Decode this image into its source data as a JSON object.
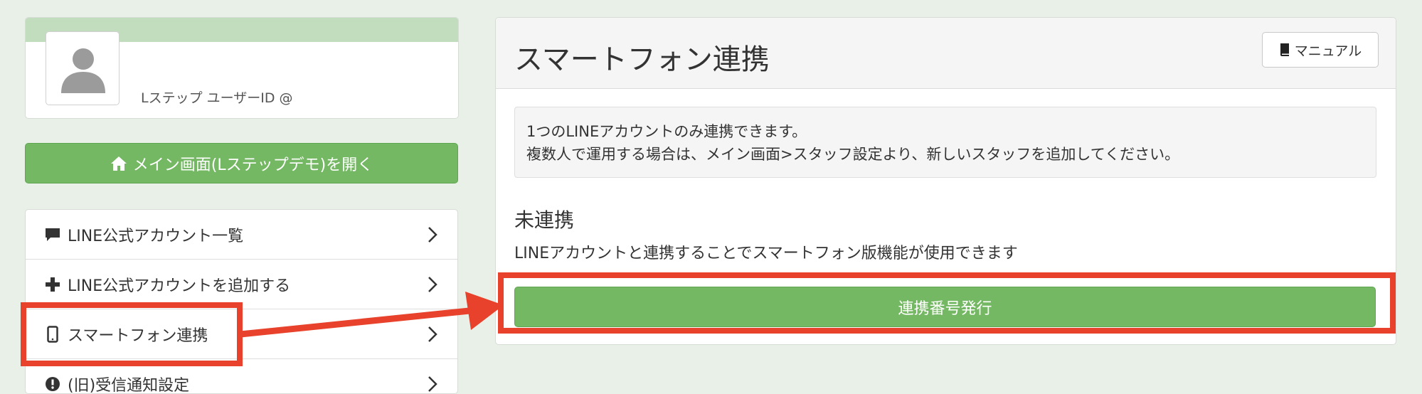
{
  "profile": {
    "user_label": "Lステップ ユーザーID @"
  },
  "main_button": {
    "label": "メイン画面(Lステップデモ)を開く"
  },
  "menu": {
    "items": [
      {
        "label": "LINE公式アカウント一覧",
        "icon": "comment-icon"
      },
      {
        "label": "LINE公式アカウントを追加する",
        "icon": "plus-icon"
      },
      {
        "label": "スマートフォン連携",
        "icon": "mobile-icon"
      },
      {
        "label": "(旧)受信通知設定",
        "icon": "exclamation-circle-icon"
      }
    ]
  },
  "panel": {
    "title": "スマートフォン連携",
    "manual_label": "マニュアル",
    "notice_line1": "1つのLINEアカウントのみ連携できます。",
    "notice_line2": "複数人で運用する場合は、メイン画面>スタッフ設定より、新しいスタッフを追加してください。",
    "status_heading": "未連携",
    "status_description": "LINEアカウントと連携することでスマートフォン版機能が使用できます",
    "issue_button_label": "連携番号発行"
  },
  "colors": {
    "green": "#74b863",
    "highlight": "#e8422c",
    "background": "#e8f0e8"
  }
}
